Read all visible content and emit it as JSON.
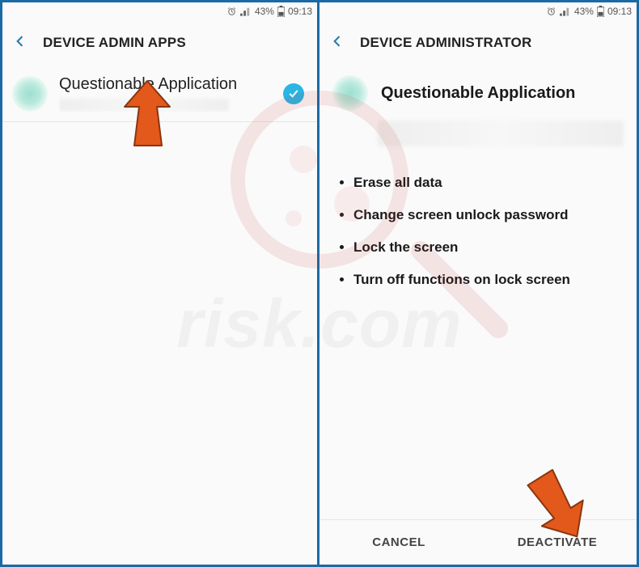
{
  "status": {
    "battery_pct": "43%",
    "time": "09:13"
  },
  "left": {
    "title": "DEVICE ADMIN APPS",
    "item": {
      "title": "Questionable Application",
      "checked": true
    }
  },
  "right": {
    "title": "DEVICE ADMINISTRATOR",
    "app_title": "Questionable Application",
    "permissions": [
      "Erase all data",
      "Change screen unlock password",
      "Lock the screen",
      "Turn off functions on lock screen"
    ],
    "buttons": {
      "cancel": "CANCEL",
      "deactivate": "DEACTIVATE"
    }
  },
  "watermark": "risk.com"
}
